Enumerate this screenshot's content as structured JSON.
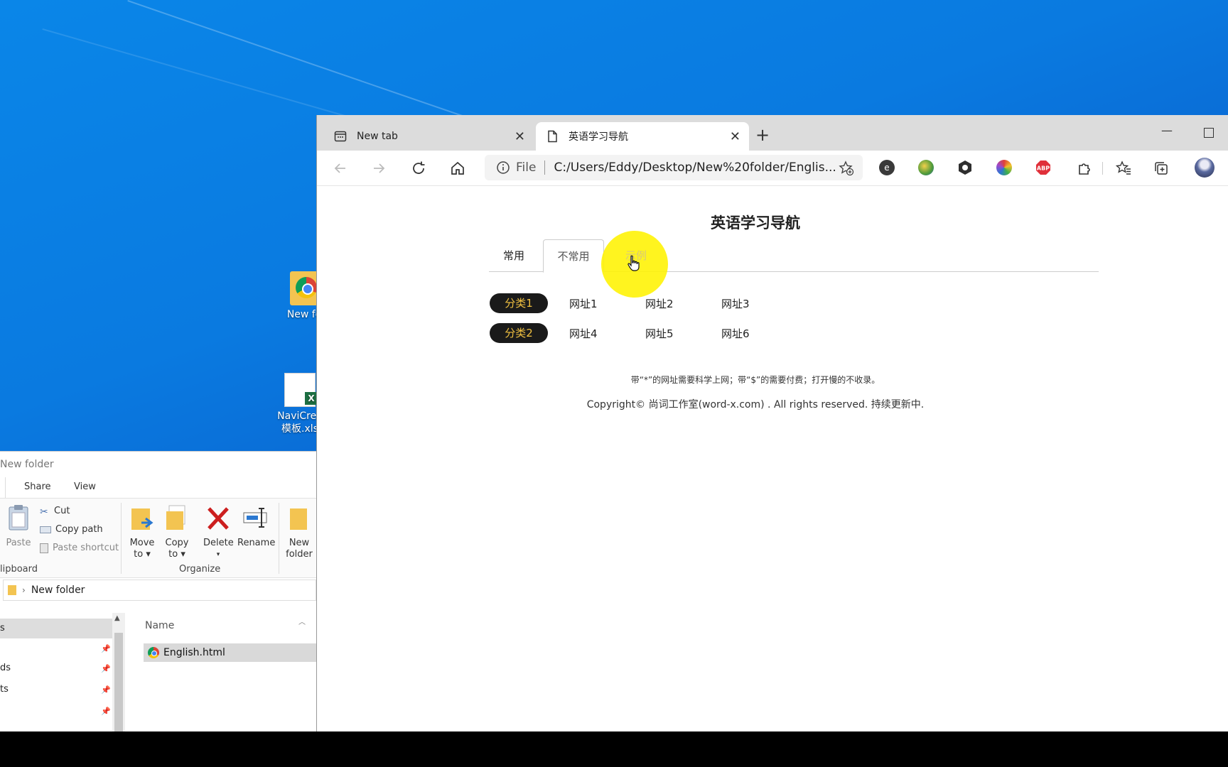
{
  "desktop": {
    "icons": [
      {
        "label": "New fol",
        "kind": "chrome-folder"
      },
      {
        "label": "NaviCrea",
        "label2": "模板.xls",
        "kind": "excel"
      }
    ]
  },
  "explorer": {
    "title": "New folder",
    "tabs": [
      "Share",
      "View"
    ],
    "ribbon": {
      "paste": "Paste",
      "cut": "Cut",
      "copy_path": "Copy path",
      "paste_shortcut": "Paste shortcut",
      "clipboard_label": "lipboard",
      "move_to": [
        "Move",
        "to"
      ],
      "copy_to": [
        "Copy",
        "to"
      ],
      "delete": "Delete",
      "rename": "Rename",
      "organize_label": "Organize",
      "new_folder": [
        "New",
        "folder"
      ]
    },
    "address": "New folder",
    "nav_items": [
      "s",
      "ds",
      "ts"
    ],
    "list": {
      "column": "Name",
      "files": [
        {
          "name": "English.html",
          "icon": "chrome-icon"
        }
      ]
    }
  },
  "browser": {
    "tabs": [
      {
        "label": "New tab",
        "icon": "new-tab-icon",
        "active": false
      },
      {
        "label": "英语学习导航",
        "icon": "page-icon",
        "active": true
      }
    ],
    "address": {
      "protocol": "File",
      "url": "C:/Users/Eddy/Desktop/New%20folder/Englis..."
    },
    "extensions": [
      {
        "name": "extension-e-icon",
        "color": "#3a3a3a"
      },
      {
        "name": "extension-globe-icon",
        "color": "#4e9a3a"
      },
      {
        "name": "extension-hex-icon",
        "color": "#2e2e2e"
      },
      {
        "name": "extension-colorwheel-icon",
        "color": "#e0403a"
      },
      {
        "name": "adblock-icon",
        "text": "ABP",
        "color": "#e0303a"
      }
    ]
  },
  "page": {
    "title": "英语学习导航",
    "tabs": [
      "常用",
      "不常用",
      "示例"
    ],
    "active_tab": 1,
    "rows": [
      {
        "category": "分类1",
        "links": [
          "网址1",
          "网址2",
          "网址3"
        ]
      },
      {
        "category": "分类2",
        "links": [
          "网址4",
          "网址5",
          "网址6"
        ]
      }
    ],
    "note": "带“*”的网址需要科学上网；带“$”的需要付费；打开慢的不收录。",
    "copyright": "Copyright© 尚词工作室(word-x.com) . All rights reserved. 持续更新中."
  },
  "colors": {
    "pill_bg": "#1a1a1a",
    "pill_text": "#f0c040",
    "highlight": "#fff200"
  }
}
